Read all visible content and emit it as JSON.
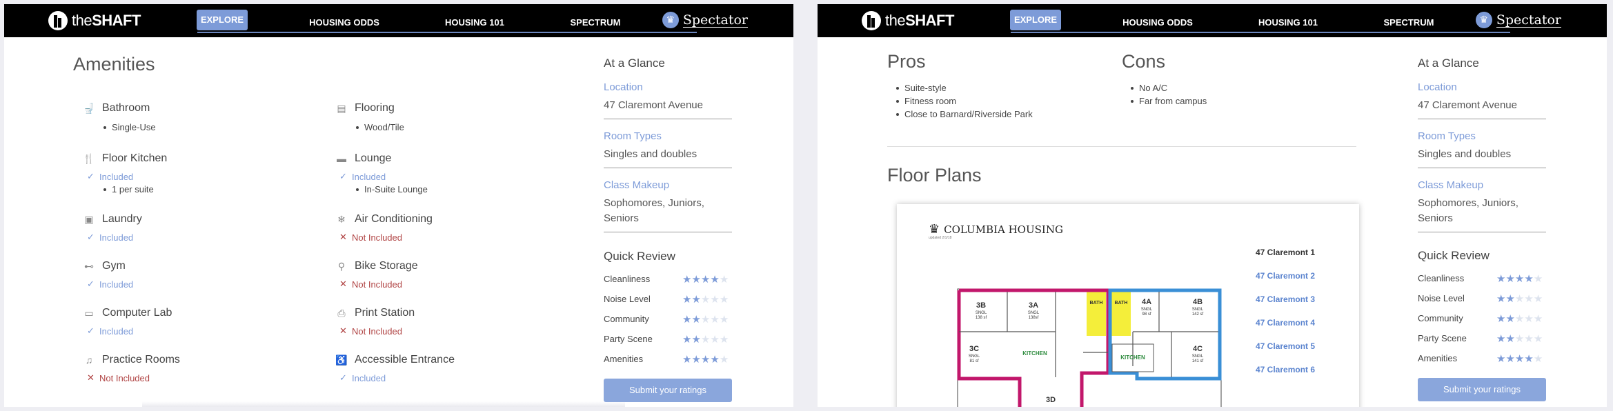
{
  "nav": {
    "logo_prefix": "the",
    "logo_bold": "SHAFT",
    "items": [
      "EXPLORE",
      "HOUSING ODDS",
      "HOUSING 101",
      "SPECTRUM"
    ],
    "spectator": "Spectator"
  },
  "amenities": {
    "title": "Amenities",
    "left": [
      {
        "name": "Bathroom",
        "icon": "toilet-icon",
        "status": "",
        "detail": "Single-Use"
      },
      {
        "name": "Floor Kitchen",
        "icon": "utensils-icon",
        "status": "Included",
        "detail": "1 per suite"
      },
      {
        "name": "Laundry",
        "icon": "washer-icon",
        "status": "Included",
        "detail": ""
      },
      {
        "name": "Gym",
        "icon": "dumbbell-icon",
        "status": "Included",
        "detail": ""
      },
      {
        "name": "Computer Lab",
        "icon": "desktop-icon",
        "status": "Included",
        "detail": ""
      },
      {
        "name": "Practice Rooms",
        "icon": "music-note-icon",
        "status": "Not Included",
        "detail": ""
      }
    ],
    "right": [
      {
        "name": "Flooring",
        "icon": "flooring-icon",
        "status": "",
        "detail": "Wood/Tile"
      },
      {
        "name": "Lounge",
        "icon": "couch-icon",
        "status": "Included",
        "detail": "In-Suite Lounge"
      },
      {
        "name": "Air Conditioning",
        "icon": "snowflake-icon",
        "status": "Not Included",
        "detail": ""
      },
      {
        "name": "Bike Storage",
        "icon": "bicycle-icon",
        "status": "Not Included",
        "detail": ""
      },
      {
        "name": "Print Station",
        "icon": "printer-icon",
        "status": "Not Included",
        "detail": ""
      },
      {
        "name": "Accessible Entrance",
        "icon": "wheelchair-icon",
        "status": "Included",
        "detail": ""
      }
    ]
  },
  "glance": {
    "title": "At a Glance",
    "location_label": "Location",
    "location_value": "47 Claremont Avenue",
    "room_label": "Room Types",
    "room_value": "Singles and doubles",
    "class_label": "Class Makeup",
    "class_value": "Sophomores, Juniors, Seniors"
  },
  "quick_review": {
    "title": "Quick Review",
    "rows": [
      {
        "label": "Cleanliness",
        "rating": 4
      },
      {
        "label": "Noise Level",
        "rating": 2
      },
      {
        "label": "Community",
        "rating": 2
      },
      {
        "label": "Party Scene",
        "rating": 2
      },
      {
        "label": "Amenities",
        "rating": 4
      }
    ],
    "submit": "Submit your ratings"
  },
  "pros": {
    "title": "Pros",
    "items": [
      "Suite-style",
      "Fitness room",
      "Close to Barnard/Riverside Park"
    ]
  },
  "cons": {
    "title": "Cons",
    "items": [
      "No A/C",
      "Far from campus"
    ]
  },
  "floor_plans": {
    "title": "Floor Plans",
    "header": "COLUMBIA HOUSING",
    "updated": "updated 2/1/18",
    "links": [
      "47 Claremont 1",
      "47 Claremont 2",
      "47 Claremont 3",
      "47 Claremont 4",
      "47 Claremont 5",
      "47 Claremont 6"
    ],
    "rooms": {
      "r3b": "3B",
      "r3b_type": "SNGL",
      "r3b_size": "138 sf",
      "r3a": "3A",
      "r3a_type": "SNGL",
      "r3a_size": "138sf",
      "r4a": "4A",
      "r4a_type": "SNGL",
      "r4a_size": "98 sf",
      "r4b": "4B",
      "r4b_type": "SNGL",
      "r4b_size": "142 sf",
      "r3c": "3C",
      "r3c_type": "SNGL",
      "r3c_size": "81 sf",
      "r4c": "4C",
      "r4c_type": "SNGL",
      "r4c_size": "141 sf",
      "r3d": "3D",
      "bath": "BATH",
      "kitchen": "KITCHEN"
    }
  },
  "colors": {
    "accent": "#7d9bd8",
    "not_included": "#b04343",
    "suite_magenta": "#c2176b",
    "suite_blue": "#3a8fd6",
    "bath_yellow": "#f4ee3a"
  }
}
